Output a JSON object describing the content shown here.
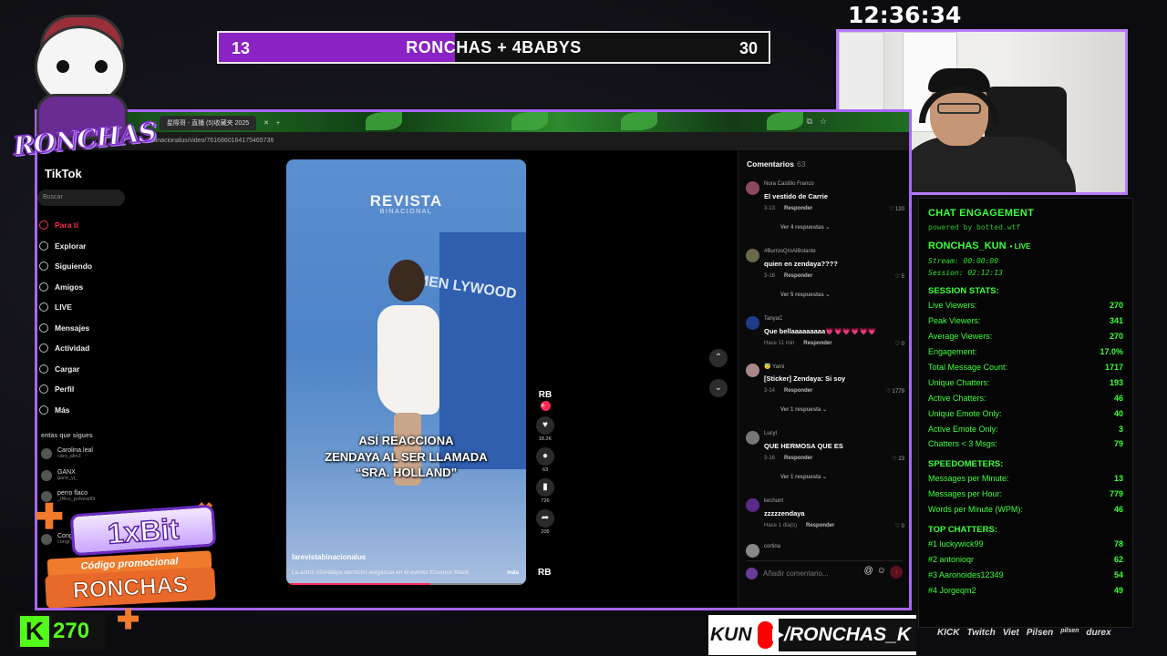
{
  "vote": {
    "title": "RONCHAS + 4BABYS",
    "left_count": "13",
    "right_count": "30",
    "fill_fraction": 0.43,
    "fill_color": "#8a22c4"
  },
  "clock": "12:36:34",
  "brand": {
    "mascot_text": "RONCHAS"
  },
  "browser": {
    "tab_title": "星際哥 - 直播 (5)收藏夹 2025",
    "url": "tabinacionalus/video/7616860164175465736"
  },
  "tiktok": {
    "logo": "TikTok",
    "search_placeholder": "Buscar",
    "nav": [
      {
        "label": "Para ti",
        "active": true
      },
      {
        "label": "Explorar"
      },
      {
        "label": "Siguiendo"
      },
      {
        "label": "Amigos"
      },
      {
        "label": "LIVE"
      },
      {
        "label": "Mensajes"
      },
      {
        "label": "Actividad"
      },
      {
        "label": "Cargar"
      },
      {
        "label": "Perfil"
      },
      {
        "label": "Más"
      }
    ],
    "following_heading": "entas que sigues",
    "following": [
      {
        "name": "Carolina.leal",
        "handle": "caro_alm3"
      },
      {
        "name": "GANX",
        "handle": "ganx_yt_"
      },
      {
        "name": "perro flaco",
        "handle": "_fl4co_polvead0r"
      },
      {
        "name": "Cong",
        "handle": "congr"
      }
    ]
  },
  "video": {
    "brand": "REVISTA",
    "brand_sub": "BINACIONAL",
    "wall_text": "WOMEN LYWOOD",
    "caption_lines": [
      "ASÍ REACCIONA",
      "ZENDAYA AL SER LLAMADA",
      "“SRA. HOLLAND”"
    ],
    "username": "larevistabinacionalus",
    "description": "La actriz #Zendaya derrochó elegancia en el evento Essence Black",
    "more_label": "más",
    "progress_fraction": 0.6
  },
  "actions": {
    "avatar_text": "RB",
    "likes": "18.2K",
    "comments": "63",
    "saves": "726",
    "shares": "205",
    "bottom_avatar_text": "RB"
  },
  "comments": {
    "heading": "Comentarios",
    "count": "63",
    "reply_label": "Responder",
    "input_placeholder": "Añadir comentario...",
    "items": [
      {
        "user": "Nora Castillo Franco",
        "text": "El vestido de Carrie",
        "date": "3-13",
        "likes": "120",
        "replies": "Ver 4 respuestas ⌄"
      },
      {
        "user": "#BurrosQroAlBolante",
        "text": "quien en zendaya????",
        "date": "3-16",
        "likes": "5",
        "replies": "Ver 5 respuestas ⌄"
      },
      {
        "user": "TanyaC",
        "text": "Que bellaaaaaaaaa💗💗💗💗💗💗",
        "date": "Hace 11 min",
        "likes": "0",
        "replies": ""
      },
      {
        "user": "😇 Yami",
        "text": "[Sticker] Zendaya: Si soy",
        "date": "3-14",
        "likes": "1779",
        "replies": "Ver 1 respuesta ⌄"
      },
      {
        "user": "Lucyl",
        "text": "QUE HERMOSA QUE ES",
        "date": "3-16",
        "likes": "23",
        "replies": "Ver 1 respuesta ⌄"
      },
      {
        "user": "kechunt",
        "text": "zzzzzendaya",
        "date": "Hace 1 día(s)",
        "likes": "0",
        "replies": ""
      },
      {
        "user": "cortina",
        "text": "",
        "date": "",
        "likes": "",
        "replies": ""
      }
    ]
  },
  "engagement": {
    "title": "CHAT ENGAGEMENT",
    "powered": "powered by botted.wtf",
    "user": "RONCHAS_KUN",
    "live_label": "• LIVE",
    "stream_line": "Stream: 00:00:00",
    "session_line": "Session: 02:12:13",
    "session_stats_heading": "SESSION STATS:",
    "session_stats": [
      {
        "label": "Live Viewers:",
        "value": "270"
      },
      {
        "label": "Peak Viewers:",
        "value": "341"
      },
      {
        "label": "Average Viewers:",
        "value": "270"
      },
      {
        "label": "Engagement:",
        "value": "17.0%"
      },
      {
        "label": "Total Message Count:",
        "value": "1717"
      },
      {
        "label": "Unique Chatters:",
        "value": "193"
      },
      {
        "label": "Active Chatters:",
        "value": "46"
      },
      {
        "label": "Unique Emote Only:",
        "value": "40"
      },
      {
        "label": "Active Emote Only:",
        "value": "3"
      },
      {
        "label": "Chatters < 3 Msgs:",
        "value": "79"
      }
    ],
    "speed_heading": "SPEEDOMETERS:",
    "speed": [
      {
        "label": "Messages per Minute:",
        "value": "13"
      },
      {
        "label": "Messages per Hour:",
        "value": "779"
      },
      {
        "label": "Words per Minute (WPM):",
        "value": "46"
      }
    ],
    "top_heading": "TOP CHATTERS:",
    "top": [
      {
        "label": "#1 luckywick99",
        "value": "78"
      },
      {
        "label": "#2 antonioqr",
        "value": "62"
      },
      {
        "label": "#3 Aaronoides12349",
        "value": "54"
      },
      {
        "label": "#4 Jorgeqm2",
        "value": "49"
      }
    ]
  },
  "promo": {
    "brand": "1xBit",
    "label": "Código promocional",
    "code": "RONCHAS"
  },
  "kick": {
    "letter": "K",
    "viewers": "270"
  },
  "youtube": {
    "prefix": "KUN",
    "handle": "/RONCHAS_K"
  },
  "sponsors": [
    "KICK",
    "Twitch",
    "Viet",
    "Pilsen",
    "pilsen",
    "durex"
  ],
  "colors": {
    "accent": "#a866ff",
    "tiktok_red": "#fe2c55",
    "engage_green": "#3cff3c",
    "kick_green": "#53fc18"
  }
}
